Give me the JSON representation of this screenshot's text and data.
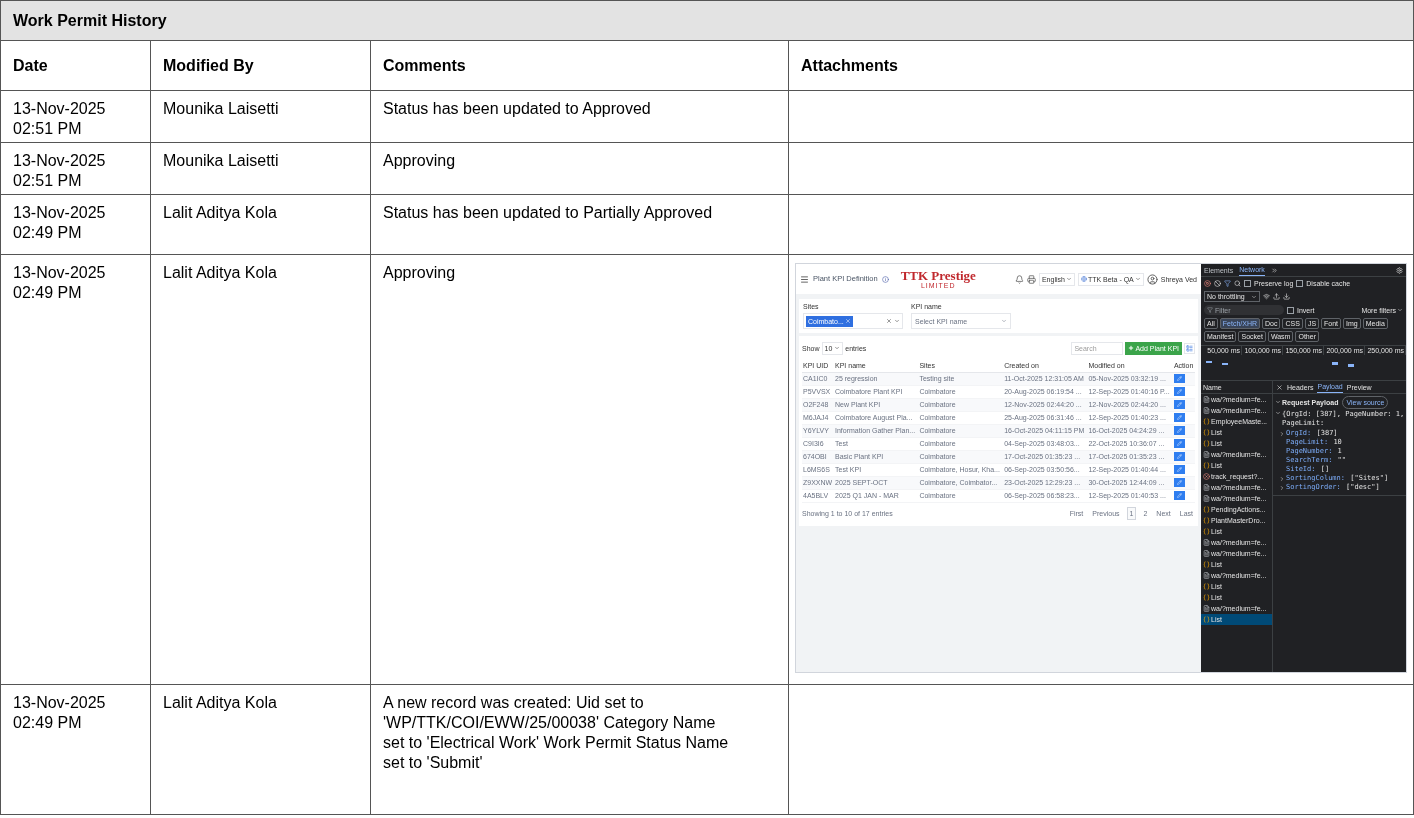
{
  "panel": {
    "title": "Work Permit History"
  },
  "columns": [
    "Date",
    "Modified By",
    "Comments",
    "Attachments"
  ],
  "rows": [
    {
      "date": "13-Nov-2025 02:51 PM",
      "modified_by": "Mounika Laisetti",
      "comment": "Status has been updated to Approved"
    },
    {
      "date": "13-Nov-2025 02:51 PM",
      "modified_by": "Mounika Laisetti",
      "comment": "Approving"
    },
    {
      "date": "13-Nov-2025 02:49 PM",
      "modified_by": "Lalit Aditya Kola",
      "comment": "Status has been updated to Partially Approved"
    },
    {
      "date": "13-Nov-2025 02:49 PM",
      "modified_by": "Lalit Aditya Kola",
      "comment": "Approving",
      "attachment": {
        "app": {
          "page_title": "Plant KPI Definition",
          "logo": "TTK Prestige",
          "logo_subtitle": "LIMITED",
          "language": "English",
          "environment": "TTK Beta - QA",
          "user": "Shreya Ved",
          "sites_filter": {
            "label": "Sites",
            "chip": "Coimbato..."
          },
          "kpi_filter": {
            "label": "KPI name",
            "placeholder": "Select KPI name"
          },
          "show": "Show",
          "page_size": "10",
          "entries": "entries",
          "search_placeholder": "Search",
          "add_button": "Add Plant KPI",
          "columns": [
            "KPI UID",
            "KPI name",
            "Sites",
            "Created on",
            "Modified on",
            "Action"
          ],
          "rows": [
            [
              "CA1IC0",
              "25 regression",
              "Testing site",
              "11-Oct-2025 12:31:05 AM",
              "05-Nov-2025 03:32:19 ..."
            ],
            [
              "P5VVSX",
              "Coimbatore Plant KPI",
              "Coimbatore",
              "20-Aug-2025 06:19:54 ...",
              "12-Sep-2025 01:40:16 P..."
            ],
            [
              "O2F248",
              "New Plant KPI",
              "Coimbatore",
              "12-Nov-2025 02:44:20 ...",
              "12-Nov-2025 02:44:20 ..."
            ],
            [
              "M6JAJ4",
              "Coimbatore August Pla...",
              "Coimbatore",
              "25-Aug-2025 06:31:46 ...",
              "12-Sep-2025 01:40:23 ..."
            ],
            [
              "Y6YLVY",
              "Information Gather Plan...",
              "Coimbatore",
              "16-Oct-2025 04:11:15 PM",
              "16-Oct-2025 04:24:29 ..."
            ],
            [
              "C9I3I6",
              "Test",
              "Coimbatore",
              "04-Sep-2025 03:48:03...",
              "22-Oct-2025 10:36:07 ..."
            ],
            [
              "674OBI",
              "Basic Plant KPI",
              "Coimbatore",
              "17-Oct-2025 01:35:23 ...",
              "17-Oct-2025 01:35:23 ..."
            ],
            [
              "L6MS6S",
              "Test KPI",
              "Coimbatore, Hosur, Kha...",
              "06-Sep-2025 03:50:56...",
              "12-Sep-2025 01:40:44 ..."
            ],
            [
              "Z9XXNW",
              "2025 SEPT-OCT",
              "Coimbatore, Coimbator...",
              "23-Oct-2025 12:29:23 ...",
              "30-Oct-2025 12:44:09 ..."
            ],
            [
              "4A5BLV",
              "2025 Q1 JAN - MAR",
              "Coimbatore",
              "06-Sep-2025 06:58:23...",
              "12-Sep-2025 01:40:53 ..."
            ]
          ],
          "summary": "Showing 1 to 10 of 17 entries",
          "pagination": [
            {
              "label": "First",
              "selected": false
            },
            {
              "label": "Previous",
              "selected": false
            },
            {
              "label": "1",
              "selected": true
            },
            {
              "label": "2",
              "selected": false
            },
            {
              "label": "Next",
              "selected": false
            },
            {
              "label": "Last",
              "selected": false
            }
          ]
        },
        "devtools": {
          "tabs": [
            {
              "label": "Elements",
              "selected": false
            },
            {
              "label": "Network",
              "selected": true
            }
          ],
          "preserve_log": {
            "label": "Preserve log",
            "checked": false
          },
          "disable_cache": {
            "label": "Disable cache",
            "checked": false
          },
          "throttling": "No throttling",
          "filter_placeholder": "Filter",
          "invert": {
            "label": "Invert",
            "checked": false
          },
          "more_filters": "More filters",
          "type_filters": [
            {
              "label": "All",
              "selected": false
            },
            {
              "label": "Fetch/XHR",
              "selected": true
            },
            {
              "label": "Doc",
              "selected": false
            },
            {
              "label": "CSS",
              "selected": false
            },
            {
              "label": "JS",
              "selected": false
            },
            {
              "label": "Font",
              "selected": false
            },
            {
              "label": "Img",
              "selected": false
            },
            {
              "label": "Media",
              "selected": false
            },
            {
              "label": "Manifest",
              "selected": false
            },
            {
              "label": "Socket",
              "selected": false
            },
            {
              "label": "Wasm",
              "selected": false
            },
            {
              "label": "Other",
              "selected": false
            }
          ],
          "timeline_ticks": [
            "50,000 ms",
            "100,000 ms",
            "150,000 ms",
            "200,000 ms",
            "250,000 ms"
          ],
          "name_header": "Name",
          "requests": [
            {
              "name": "wa/?medium=fe...",
              "kind": "doc",
              "selected": false
            },
            {
              "name": "wa/?medium=fe...",
              "kind": "doc",
              "selected": false
            },
            {
              "name": "EmployeeMaste...",
              "kind": "xhr",
              "selected": false
            },
            {
              "name": "List",
              "kind": "xhr",
              "selected": false
            },
            {
              "name": "List",
              "kind": "xhr",
              "selected": false
            },
            {
              "name": "wa/?medium=fe...",
              "kind": "doc",
              "selected": false
            },
            {
              "name": "List",
              "kind": "xhr",
              "selected": false
            },
            {
              "name": "track_request?...",
              "kind": "error",
              "selected": false
            },
            {
              "name": "wa/?medium=fe...",
              "kind": "doc",
              "selected": false
            },
            {
              "name": "wa/?medium=fe...",
              "kind": "doc",
              "selected": false
            },
            {
              "name": "PendingActions...",
              "kind": "xhr",
              "selected": false
            },
            {
              "name": "PlantMasterDro...",
              "kind": "xhr",
              "selected": false
            },
            {
              "name": "List",
              "kind": "xhr",
              "selected": false
            },
            {
              "name": "wa/?medium=fe...",
              "kind": "doc",
              "selected": false
            },
            {
              "name": "wa/?medium=fe...",
              "kind": "doc",
              "selected": false
            },
            {
              "name": "List",
              "kind": "xhr",
              "selected": false
            },
            {
              "name": "wa/?medium=fe...",
              "kind": "doc",
              "selected": false
            },
            {
              "name": "List",
              "kind": "xhr",
              "selected": false
            },
            {
              "name": "List",
              "kind": "xhr",
              "selected": false
            },
            {
              "name": "wa/?medium=fe...",
              "kind": "doc",
              "selected": false
            },
            {
              "name": "List",
              "kind": "xhr",
              "selected": true
            }
          ],
          "detail_tabs": [
            {
              "label": "Headers",
              "selected": false
            },
            {
              "label": "Payload",
              "selected": true
            },
            {
              "label": "Preview",
              "selected": false
            }
          ],
          "payload_title": "Request Payload",
          "view_source": "View source",
          "payload_summary": "{OrgId: [387], PageNumber: 1, PageLimit:",
          "payload_fields": [
            {
              "key": "OrgId:",
              "value": "[387]",
              "expandable": true
            },
            {
              "key": "PageLimit:",
              "value": "10",
              "expandable": false
            },
            {
              "key": "PageNumber:",
              "value": "1",
              "expandable": false
            },
            {
              "key": "SearchTerm:",
              "value": "\"\"",
              "expandable": false
            },
            {
              "key": "SiteId:",
              "value": "[]",
              "expandable": false
            },
            {
              "key": "SortingColumn:",
              "value": "[\"Sites\"]",
              "expandable": true
            },
            {
              "key": "SortingOrder:",
              "value": "[\"desc\"]",
              "expandable": true
            }
          ]
        }
      }
    },
    {
      "date": "13-Nov-2025 02:49 PM",
      "modified_by": "Lalit Aditya Kola",
      "comment": "A new record was created: Uid set to 'WP/TTK/COI/EWW/25/00038' Category Name set to 'Electrical Work' Work Permit Status Name set to 'Submit'"
    }
  ]
}
